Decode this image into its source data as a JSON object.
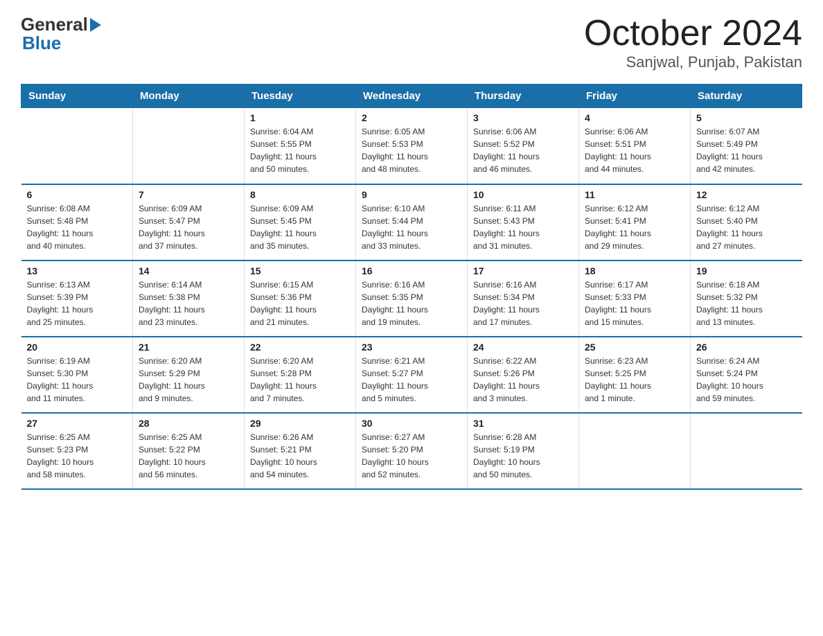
{
  "header": {
    "logo_general": "General",
    "logo_blue": "Blue",
    "title": "October 2024",
    "subtitle": "Sanjwal, Punjab, Pakistan"
  },
  "days_of_week": [
    "Sunday",
    "Monday",
    "Tuesday",
    "Wednesday",
    "Thursday",
    "Friday",
    "Saturday"
  ],
  "weeks": [
    [
      {
        "day": "",
        "info": ""
      },
      {
        "day": "",
        "info": ""
      },
      {
        "day": "1",
        "info": "Sunrise: 6:04 AM\nSunset: 5:55 PM\nDaylight: 11 hours\nand 50 minutes."
      },
      {
        "day": "2",
        "info": "Sunrise: 6:05 AM\nSunset: 5:53 PM\nDaylight: 11 hours\nand 48 minutes."
      },
      {
        "day": "3",
        "info": "Sunrise: 6:06 AM\nSunset: 5:52 PM\nDaylight: 11 hours\nand 46 minutes."
      },
      {
        "day": "4",
        "info": "Sunrise: 6:06 AM\nSunset: 5:51 PM\nDaylight: 11 hours\nand 44 minutes."
      },
      {
        "day": "5",
        "info": "Sunrise: 6:07 AM\nSunset: 5:49 PM\nDaylight: 11 hours\nand 42 minutes."
      }
    ],
    [
      {
        "day": "6",
        "info": "Sunrise: 6:08 AM\nSunset: 5:48 PM\nDaylight: 11 hours\nand 40 minutes."
      },
      {
        "day": "7",
        "info": "Sunrise: 6:09 AM\nSunset: 5:47 PM\nDaylight: 11 hours\nand 37 minutes."
      },
      {
        "day": "8",
        "info": "Sunrise: 6:09 AM\nSunset: 5:45 PM\nDaylight: 11 hours\nand 35 minutes."
      },
      {
        "day": "9",
        "info": "Sunrise: 6:10 AM\nSunset: 5:44 PM\nDaylight: 11 hours\nand 33 minutes."
      },
      {
        "day": "10",
        "info": "Sunrise: 6:11 AM\nSunset: 5:43 PM\nDaylight: 11 hours\nand 31 minutes."
      },
      {
        "day": "11",
        "info": "Sunrise: 6:12 AM\nSunset: 5:41 PM\nDaylight: 11 hours\nand 29 minutes."
      },
      {
        "day": "12",
        "info": "Sunrise: 6:12 AM\nSunset: 5:40 PM\nDaylight: 11 hours\nand 27 minutes."
      }
    ],
    [
      {
        "day": "13",
        "info": "Sunrise: 6:13 AM\nSunset: 5:39 PM\nDaylight: 11 hours\nand 25 minutes."
      },
      {
        "day": "14",
        "info": "Sunrise: 6:14 AM\nSunset: 5:38 PM\nDaylight: 11 hours\nand 23 minutes."
      },
      {
        "day": "15",
        "info": "Sunrise: 6:15 AM\nSunset: 5:36 PM\nDaylight: 11 hours\nand 21 minutes."
      },
      {
        "day": "16",
        "info": "Sunrise: 6:16 AM\nSunset: 5:35 PM\nDaylight: 11 hours\nand 19 minutes."
      },
      {
        "day": "17",
        "info": "Sunrise: 6:16 AM\nSunset: 5:34 PM\nDaylight: 11 hours\nand 17 minutes."
      },
      {
        "day": "18",
        "info": "Sunrise: 6:17 AM\nSunset: 5:33 PM\nDaylight: 11 hours\nand 15 minutes."
      },
      {
        "day": "19",
        "info": "Sunrise: 6:18 AM\nSunset: 5:32 PM\nDaylight: 11 hours\nand 13 minutes."
      }
    ],
    [
      {
        "day": "20",
        "info": "Sunrise: 6:19 AM\nSunset: 5:30 PM\nDaylight: 11 hours\nand 11 minutes."
      },
      {
        "day": "21",
        "info": "Sunrise: 6:20 AM\nSunset: 5:29 PM\nDaylight: 11 hours\nand 9 minutes."
      },
      {
        "day": "22",
        "info": "Sunrise: 6:20 AM\nSunset: 5:28 PM\nDaylight: 11 hours\nand 7 minutes."
      },
      {
        "day": "23",
        "info": "Sunrise: 6:21 AM\nSunset: 5:27 PM\nDaylight: 11 hours\nand 5 minutes."
      },
      {
        "day": "24",
        "info": "Sunrise: 6:22 AM\nSunset: 5:26 PM\nDaylight: 11 hours\nand 3 minutes."
      },
      {
        "day": "25",
        "info": "Sunrise: 6:23 AM\nSunset: 5:25 PM\nDaylight: 11 hours\nand 1 minute."
      },
      {
        "day": "26",
        "info": "Sunrise: 6:24 AM\nSunset: 5:24 PM\nDaylight: 10 hours\nand 59 minutes."
      }
    ],
    [
      {
        "day": "27",
        "info": "Sunrise: 6:25 AM\nSunset: 5:23 PM\nDaylight: 10 hours\nand 58 minutes."
      },
      {
        "day": "28",
        "info": "Sunrise: 6:25 AM\nSunset: 5:22 PM\nDaylight: 10 hours\nand 56 minutes."
      },
      {
        "day": "29",
        "info": "Sunrise: 6:26 AM\nSunset: 5:21 PM\nDaylight: 10 hours\nand 54 minutes."
      },
      {
        "day": "30",
        "info": "Sunrise: 6:27 AM\nSunset: 5:20 PM\nDaylight: 10 hours\nand 52 minutes."
      },
      {
        "day": "31",
        "info": "Sunrise: 6:28 AM\nSunset: 5:19 PM\nDaylight: 10 hours\nand 50 minutes."
      },
      {
        "day": "",
        "info": ""
      },
      {
        "day": "",
        "info": ""
      }
    ]
  ]
}
